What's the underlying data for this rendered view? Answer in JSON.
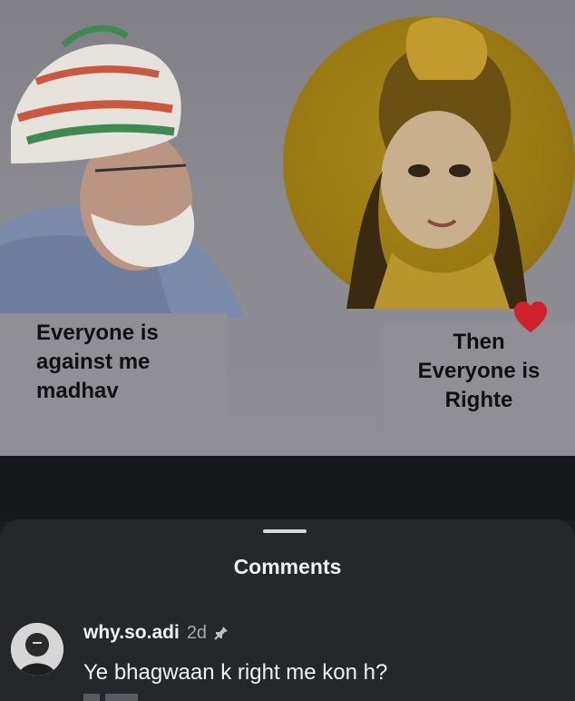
{
  "post": {
    "caption_left": [
      "Everyone is",
      "against  me",
      "madhav"
    ],
    "caption_right": [
      "Then",
      "Everyone is",
      "Righte"
    ],
    "liked_icon": "heart-icon",
    "colors": {
      "halo": "#9a7a12",
      "caption_bg": "#8f8f95",
      "heart": "#d0202c"
    }
  },
  "comments_sheet": {
    "title": "Comments",
    "comments": [
      {
        "username": "why.so.adi",
        "time": "2d",
        "pinned_icon": "pin-icon",
        "text": "Ye bhagwaan k right me kon h?"
      }
    ]
  }
}
